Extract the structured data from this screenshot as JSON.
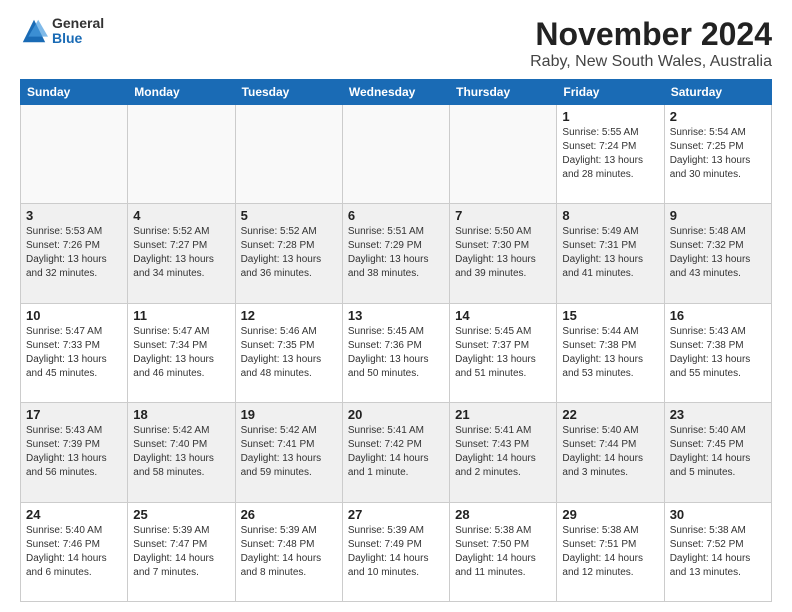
{
  "logo": {
    "general": "General",
    "blue": "Blue"
  },
  "title": "November 2024",
  "subtitle": "Raby, New South Wales, Australia",
  "weekdays": [
    "Sunday",
    "Monday",
    "Tuesday",
    "Wednesday",
    "Thursday",
    "Friday",
    "Saturday"
  ],
  "weeks": [
    [
      {
        "day": "",
        "info": ""
      },
      {
        "day": "",
        "info": ""
      },
      {
        "day": "",
        "info": ""
      },
      {
        "day": "",
        "info": ""
      },
      {
        "day": "",
        "info": ""
      },
      {
        "day": "1",
        "info": "Sunrise: 5:55 AM\nSunset: 7:24 PM\nDaylight: 13 hours\nand 28 minutes."
      },
      {
        "day": "2",
        "info": "Sunrise: 5:54 AM\nSunset: 7:25 PM\nDaylight: 13 hours\nand 30 minutes."
      }
    ],
    [
      {
        "day": "3",
        "info": "Sunrise: 5:53 AM\nSunset: 7:26 PM\nDaylight: 13 hours\nand 32 minutes."
      },
      {
        "day": "4",
        "info": "Sunrise: 5:52 AM\nSunset: 7:27 PM\nDaylight: 13 hours\nand 34 minutes."
      },
      {
        "day": "5",
        "info": "Sunrise: 5:52 AM\nSunset: 7:28 PM\nDaylight: 13 hours\nand 36 minutes."
      },
      {
        "day": "6",
        "info": "Sunrise: 5:51 AM\nSunset: 7:29 PM\nDaylight: 13 hours\nand 38 minutes."
      },
      {
        "day": "7",
        "info": "Sunrise: 5:50 AM\nSunset: 7:30 PM\nDaylight: 13 hours\nand 39 minutes."
      },
      {
        "day": "8",
        "info": "Sunrise: 5:49 AM\nSunset: 7:31 PM\nDaylight: 13 hours\nand 41 minutes."
      },
      {
        "day": "9",
        "info": "Sunrise: 5:48 AM\nSunset: 7:32 PM\nDaylight: 13 hours\nand 43 minutes."
      }
    ],
    [
      {
        "day": "10",
        "info": "Sunrise: 5:47 AM\nSunset: 7:33 PM\nDaylight: 13 hours\nand 45 minutes."
      },
      {
        "day": "11",
        "info": "Sunrise: 5:47 AM\nSunset: 7:34 PM\nDaylight: 13 hours\nand 46 minutes."
      },
      {
        "day": "12",
        "info": "Sunrise: 5:46 AM\nSunset: 7:35 PM\nDaylight: 13 hours\nand 48 minutes."
      },
      {
        "day": "13",
        "info": "Sunrise: 5:45 AM\nSunset: 7:36 PM\nDaylight: 13 hours\nand 50 minutes."
      },
      {
        "day": "14",
        "info": "Sunrise: 5:45 AM\nSunset: 7:37 PM\nDaylight: 13 hours\nand 51 minutes."
      },
      {
        "day": "15",
        "info": "Sunrise: 5:44 AM\nSunset: 7:38 PM\nDaylight: 13 hours\nand 53 minutes."
      },
      {
        "day": "16",
        "info": "Sunrise: 5:43 AM\nSunset: 7:38 PM\nDaylight: 13 hours\nand 55 minutes."
      }
    ],
    [
      {
        "day": "17",
        "info": "Sunrise: 5:43 AM\nSunset: 7:39 PM\nDaylight: 13 hours\nand 56 minutes."
      },
      {
        "day": "18",
        "info": "Sunrise: 5:42 AM\nSunset: 7:40 PM\nDaylight: 13 hours\nand 58 minutes."
      },
      {
        "day": "19",
        "info": "Sunrise: 5:42 AM\nSunset: 7:41 PM\nDaylight: 13 hours\nand 59 minutes."
      },
      {
        "day": "20",
        "info": "Sunrise: 5:41 AM\nSunset: 7:42 PM\nDaylight: 14 hours\nand 1 minute."
      },
      {
        "day": "21",
        "info": "Sunrise: 5:41 AM\nSunset: 7:43 PM\nDaylight: 14 hours\nand 2 minutes."
      },
      {
        "day": "22",
        "info": "Sunrise: 5:40 AM\nSunset: 7:44 PM\nDaylight: 14 hours\nand 3 minutes."
      },
      {
        "day": "23",
        "info": "Sunrise: 5:40 AM\nSunset: 7:45 PM\nDaylight: 14 hours\nand 5 minutes."
      }
    ],
    [
      {
        "day": "24",
        "info": "Sunrise: 5:40 AM\nSunset: 7:46 PM\nDaylight: 14 hours\nand 6 minutes."
      },
      {
        "day": "25",
        "info": "Sunrise: 5:39 AM\nSunset: 7:47 PM\nDaylight: 14 hours\nand 7 minutes."
      },
      {
        "day": "26",
        "info": "Sunrise: 5:39 AM\nSunset: 7:48 PM\nDaylight: 14 hours\nand 8 minutes."
      },
      {
        "day": "27",
        "info": "Sunrise: 5:39 AM\nSunset: 7:49 PM\nDaylight: 14 hours\nand 10 minutes."
      },
      {
        "day": "28",
        "info": "Sunrise: 5:38 AM\nSunset: 7:50 PM\nDaylight: 14 hours\nand 11 minutes."
      },
      {
        "day": "29",
        "info": "Sunrise: 5:38 AM\nSunset: 7:51 PM\nDaylight: 14 hours\nand 12 minutes."
      },
      {
        "day": "30",
        "info": "Sunrise: 5:38 AM\nSunset: 7:52 PM\nDaylight: 14 hours\nand 13 minutes."
      }
    ]
  ]
}
